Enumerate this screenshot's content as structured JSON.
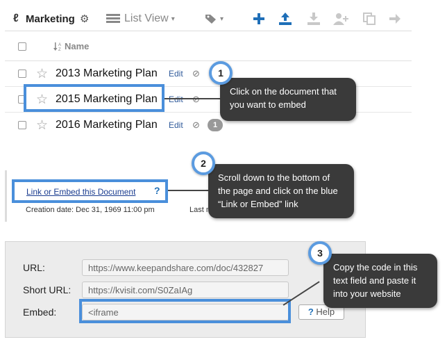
{
  "panel1": {
    "folder_glyph": "ℓ",
    "folder_name": "Marketing",
    "gear_icon": "⚙",
    "list_view_label": "List View",
    "caret": "▾",
    "tag_icon": "⬥",
    "name_header": "Name",
    "edit_label": "Edit",
    "rows": [
      {
        "title": "2013 Marketing Plan",
        "badge": ""
      },
      {
        "title": "2015 Marketing Plan",
        "badge": ""
      },
      {
        "title": "2016 Marketing Plan",
        "badge": "1"
      }
    ]
  },
  "panel2": {
    "link_label": "Link or Embed this Document",
    "help_mark": "?",
    "creation_date": "Creation date: Dec 31, 1969 11:00 pm",
    "last_mod": "Last m"
  },
  "panel3": {
    "url_label": "URL:",
    "url_value": "https://www.keepandshare.com/doc/432827",
    "short_url_label": "Short URL:",
    "short_url_value": "https://kvisit.com/S0ZaIAg",
    "embed_label": "Embed:",
    "embed_value": "<iframe",
    "help_q": "?",
    "help_label": "Help"
  },
  "callouts": [
    {
      "number": "1",
      "text": "Click on the document that you want to embed"
    },
    {
      "number": "2",
      "text": "Scroll down to the bottom of the page and click on the blue “Link or Embed” link"
    },
    {
      "number": "3",
      "text": "Copy the code in this text field and paste it into your website"
    }
  ],
  "colors": {
    "accent": "#1f6fb8",
    "highlight": "#4a8fdb",
    "callout_bg": "#3a3a3a"
  }
}
